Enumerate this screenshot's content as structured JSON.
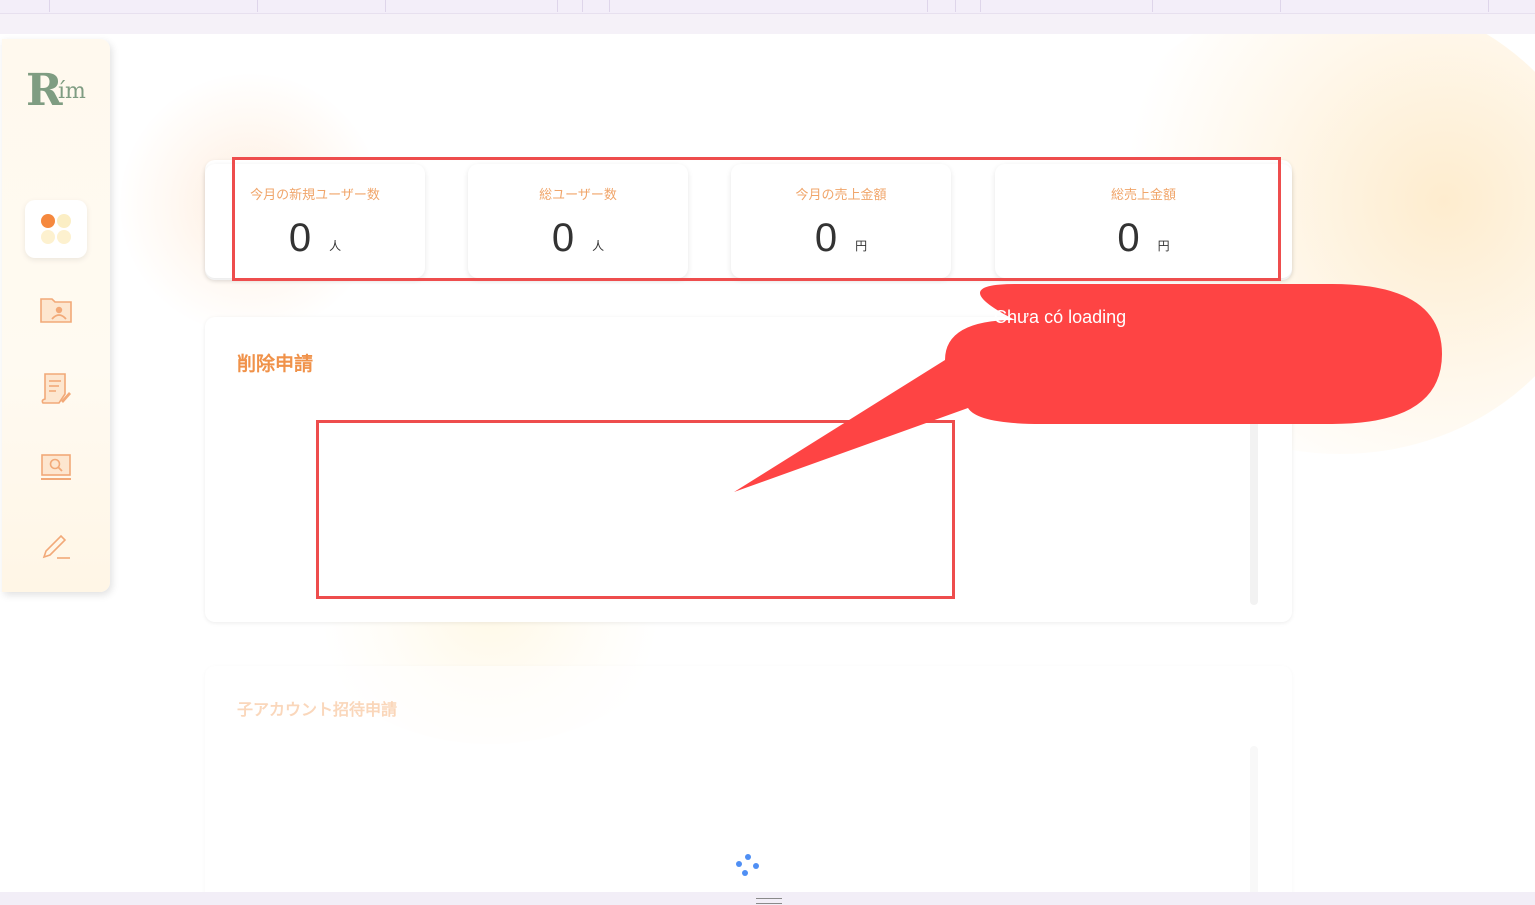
{
  "sidebar": {
    "logo": {
      "main": "R",
      "sub": "ím"
    },
    "items": [
      {
        "icon": "dashboard-dots-icon",
        "active": true
      },
      {
        "icon": "user-folder-icon",
        "active": false
      },
      {
        "icon": "document-edit-icon",
        "active": false
      },
      {
        "icon": "monitor-search-icon",
        "active": false
      },
      {
        "icon": "pen-icon",
        "active": false
      }
    ]
  },
  "stats": [
    {
      "label": "今月の新規ユーザー数",
      "value": "0",
      "unit": "人"
    },
    {
      "label": "総ユーザー数",
      "value": "0",
      "unit": "人"
    },
    {
      "label": "今月の売上金額",
      "value": "0",
      "unit": "円"
    },
    {
      "label": "総売上金額",
      "value": "0",
      "unit": "円"
    }
  ],
  "delete_requests": {
    "title": "削除申請"
  },
  "invite_requests": {
    "title": "子アカウント招待申請"
  },
  "annotation": {
    "text": "Chưa có loading",
    "color": "#fe4444"
  },
  "colors": {
    "accent": "#f0924a",
    "label": "#f0a56a",
    "logo": "#7f9d82",
    "spinner": "#4f8ff4"
  }
}
